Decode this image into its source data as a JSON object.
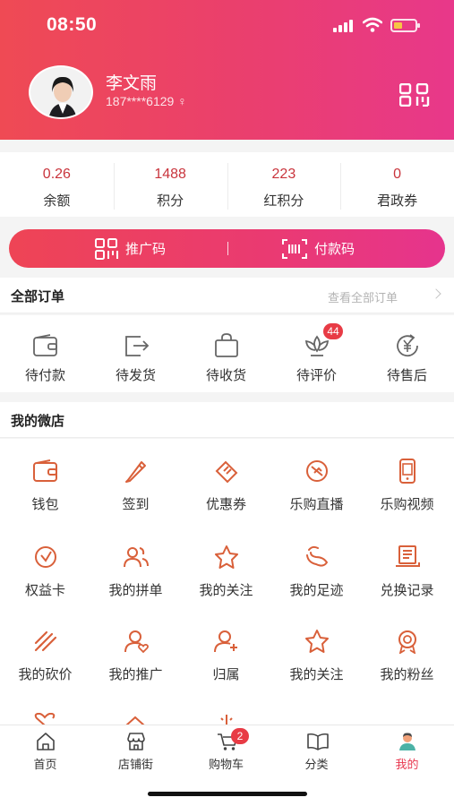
{
  "status_bar": {
    "time": "08:50",
    "battery_level": 0.4
  },
  "profile": {
    "name": "李文雨",
    "phone": "187****6129"
  },
  "stats": [
    {
      "value": "0.26",
      "label": "余额"
    },
    {
      "value": "1488",
      "label": "积分"
    },
    {
      "value": "223",
      "label": "红积分"
    },
    {
      "value": "0",
      "label": "君政券"
    }
  ],
  "codes": {
    "promo": "推广码",
    "pay": "付款码"
  },
  "orders": {
    "title": "全部订单",
    "view_all": "查看全部订单",
    "items": [
      {
        "label": "待付款",
        "icon": "wallet-icon"
      },
      {
        "label": "待发货",
        "icon": "ship-icon"
      },
      {
        "label": "待收货",
        "icon": "bag-icon"
      },
      {
        "label": "待评价",
        "icon": "lotus-icon",
        "badge": "44"
      },
      {
        "label": "待售后",
        "icon": "yen-refresh-icon"
      }
    ]
  },
  "shop": {
    "title": "我的微店",
    "items": [
      {
        "label": "钱包",
        "icon": "wallet-icon"
      },
      {
        "label": "签到",
        "icon": "pen-icon"
      },
      {
        "label": "优惠券",
        "icon": "coupon-icon"
      },
      {
        "label": "乐购直播",
        "icon": "live-icon"
      },
      {
        "label": "乐购视频",
        "icon": "phone-icon"
      },
      {
        "label": "权益卡",
        "icon": "card-clock-icon"
      },
      {
        "label": "我的拼单",
        "icon": "group-icon"
      },
      {
        "label": "我的关注",
        "icon": "star-icon"
      },
      {
        "label": "我的足迹",
        "icon": "footprint-icon"
      },
      {
        "label": "兑换记录",
        "icon": "book-icon"
      },
      {
        "label": "我的砍价",
        "icon": "bargain-icon"
      },
      {
        "label": "我的推广",
        "icon": "user-heart-icon"
      },
      {
        "label": "归属",
        "icon": "user-plus-icon"
      },
      {
        "label": "我的关注",
        "icon": "star-icon"
      },
      {
        "label": "我的粉丝",
        "icon": "medal-icon"
      }
    ]
  },
  "tabs": [
    {
      "label": "首页",
      "icon": "home-icon"
    },
    {
      "label": "店铺街",
      "icon": "store-icon"
    },
    {
      "label": "购物车",
      "icon": "cart-icon",
      "badge": "2"
    },
    {
      "label": "分类",
      "icon": "book-open-icon"
    },
    {
      "label": "我的",
      "icon": "person-icon",
      "active": true
    }
  ],
  "colors": {
    "brand": "#e8384f",
    "icon": "#d9603a",
    "header_start": "#ef4a54",
    "header_end": "#e8388a"
  }
}
